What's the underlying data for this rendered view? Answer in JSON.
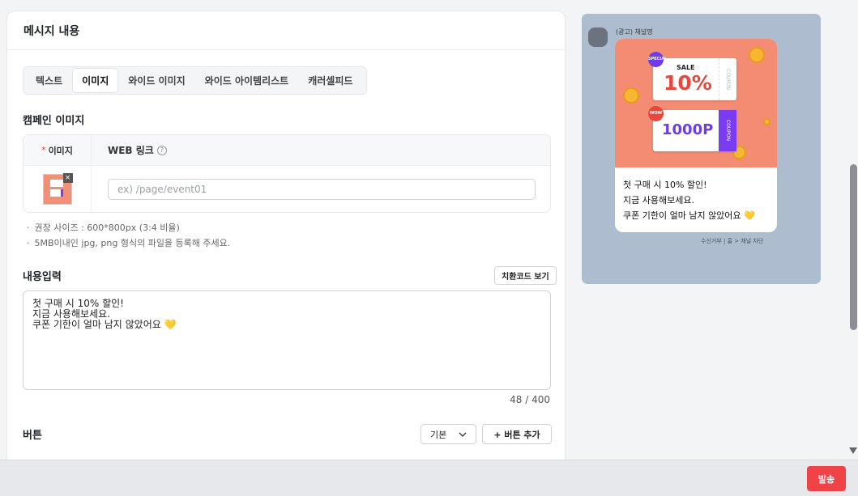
{
  "card": {
    "title": "메시지 내용"
  },
  "tabs": [
    {
      "label": "텍스트",
      "active": false
    },
    {
      "label": "이미지",
      "active": true
    },
    {
      "label": "와이드 이미지",
      "active": false
    },
    {
      "label": "와이드 아이템리스트",
      "active": false
    },
    {
      "label": "캐러셀피드",
      "active": false
    }
  ],
  "campaign": {
    "title": "캠페인 이미지",
    "required_mark": "*",
    "image_label": "이미지",
    "web_link_label": "WEB 링크",
    "help_glyph": "?",
    "remove_glyph": "×",
    "url_placeholder": "ex) /page/event01",
    "notes": [
      "권장 사이즈 : 600*800px (3:4 비율)",
      "5MB이내인 jpg, png 형식의 파일을 등록해 주세요."
    ]
  },
  "content": {
    "title": "내용입력",
    "replace_code_button": "치환코드 보기",
    "text": "첫 구매 시 10% 할인!\n지금 사용해보세요.\n쿠폰 기한이 얼마 남지 않았어요 💛",
    "counter": "48 / 400"
  },
  "buttons_section": {
    "title": "버튼",
    "dropdown_value": "기본",
    "add_button": "+ 버튼 추가"
  },
  "preview": {
    "channel_name": "(광고) 채널명",
    "coupon1_badge": "SPECIAL",
    "coupon1_label": "SALE",
    "coupon1_value": "10%",
    "coupon_stub": "COUPON",
    "coupon2_badge": "WOW",
    "coupon2_value": "1000P",
    "message": "첫 구매 시 10% 할인!\n지금 사용해보세요.\n쿠폰 기한이 얼마 남지 않았어요 💛",
    "footer": "수신거부 | 홈 > 채널 차단"
  },
  "actions": {
    "send": "발송"
  },
  "colors": {
    "accent": "#ef4348",
    "preview_bg": "#adbdcf",
    "banner": "#f48c74",
    "purple": "#6d3ce6"
  }
}
